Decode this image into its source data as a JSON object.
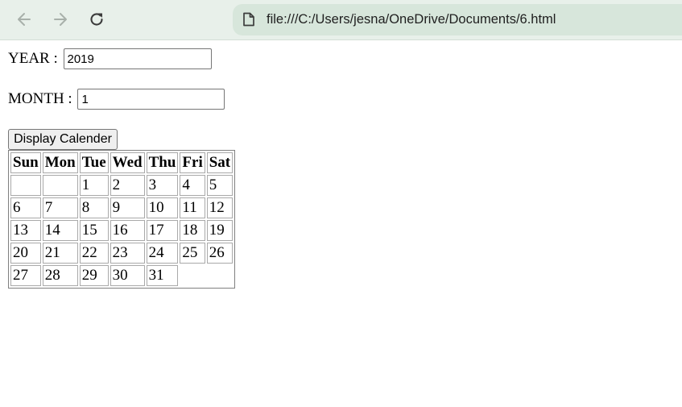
{
  "browser": {
    "url": "file:///C:/Users/jesna/OneDrive/Documents/6.html",
    "icons": {
      "back": "back-arrow-icon",
      "forward": "forward-arrow-icon",
      "reload": "reload-icon",
      "page": "file-icon"
    }
  },
  "form": {
    "year_label": "YEAR :",
    "year_value": "2019",
    "month_label": "MONTH :",
    "month_value": "1",
    "button_label": "Display Calender"
  },
  "calendar": {
    "headers": [
      "Sun",
      "Mon",
      "Tue",
      "Wed",
      "Thu",
      "Fri",
      "Sat"
    ],
    "weeks": [
      [
        "",
        "",
        "1",
        "2",
        "3",
        "4",
        "5"
      ],
      [
        "6",
        "7",
        "8",
        "9",
        "10",
        "11",
        "12"
      ],
      [
        "13",
        "14",
        "15",
        "16",
        "17",
        "18",
        "19"
      ],
      [
        "20",
        "21",
        "22",
        "23",
        "24",
        "25",
        "26"
      ],
      [
        "27",
        "28",
        "29",
        "30",
        "31"
      ]
    ]
  }
}
